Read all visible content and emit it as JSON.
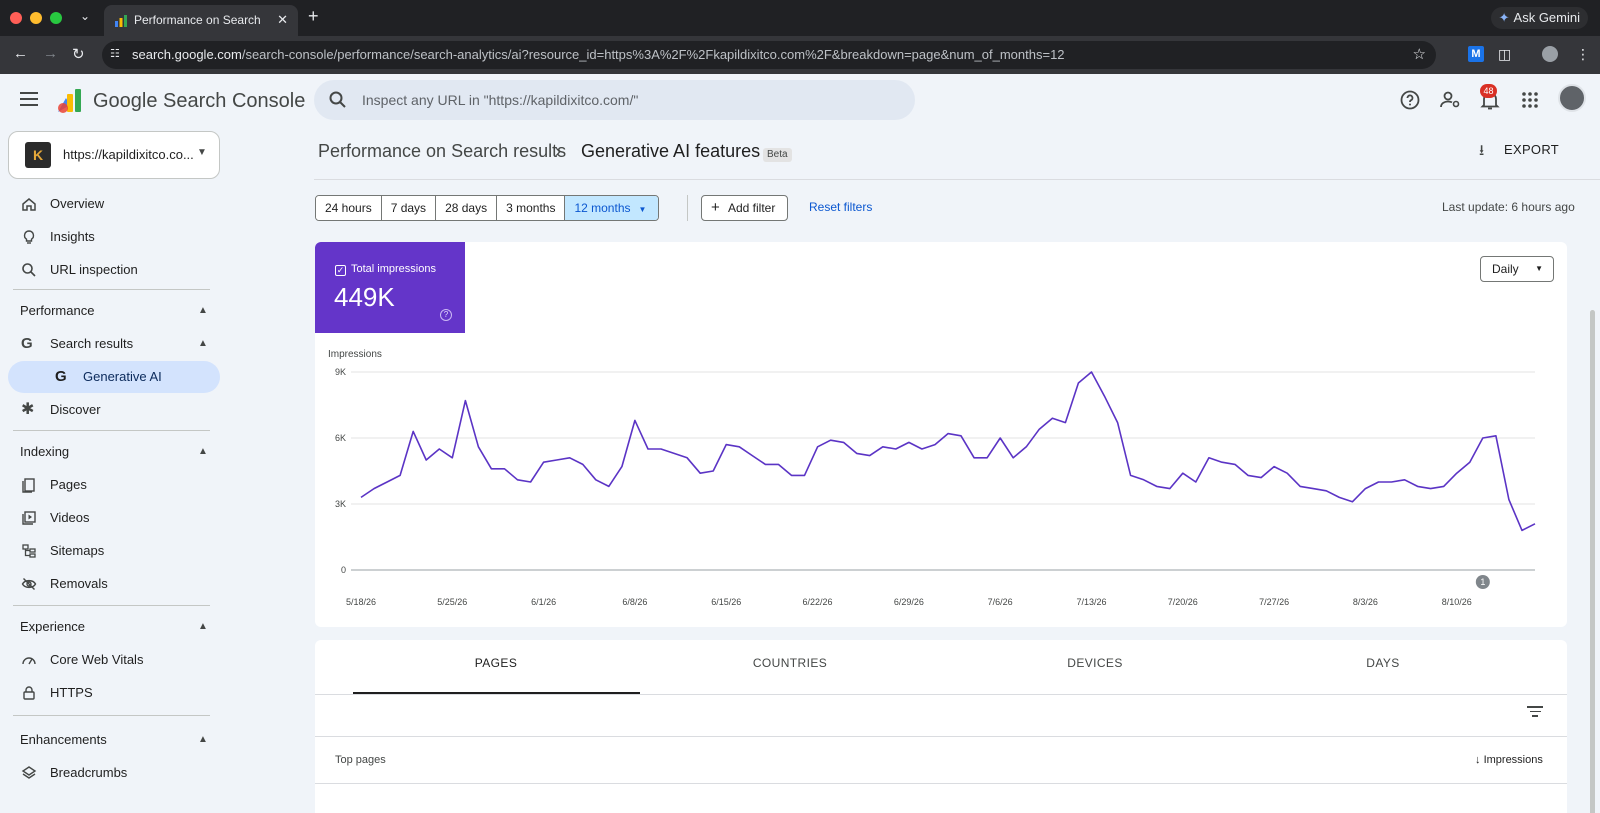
{
  "browser": {
    "tab_title": "Performance on Search generative AI",
    "new_tab": "+",
    "gemini_label": "Ask Gemini",
    "url_host": "search.google.com",
    "url_path": "/search-console/performance/search-analytics/ai?resource_id=https%3A%2F%2Fkapildixitco.com%2F&breakdown=page&num_of_months=12"
  },
  "header": {
    "product_name": "Google Search Console",
    "inspect_placeholder": "Inspect any URL in \"https://kapildixitco.com/\"",
    "notifications_count": "48"
  },
  "property": {
    "logo_text": "K",
    "url": "https://kapildixitco.co..."
  },
  "sidebar": {
    "overview": "Overview",
    "insights": "Insights",
    "url_inspection": "URL inspection",
    "performance_header": "Performance",
    "search_results": "Search results",
    "generative_ai": "Generative AI",
    "discover": "Discover",
    "indexing_header": "Indexing",
    "pages": "Pages",
    "videos": "Videos",
    "sitemaps": "Sitemaps",
    "removals": "Removals",
    "experience_header": "Experience",
    "core_web_vitals": "Core Web Vitals",
    "https": "HTTPS",
    "enhancements_header": "Enhancements",
    "breadcrumbs": "Breadcrumbs"
  },
  "main": {
    "breadcrumb_parent": "Performance on Search results",
    "breadcrumb_current": "Generative AI features",
    "beta_badge": "Beta",
    "export_label": "EXPORT",
    "date_ranges": [
      "24 hours",
      "7 days",
      "28 days",
      "3 months",
      "12 months"
    ],
    "selected_range": "12 months",
    "add_filter": "Add filter",
    "reset_filters": "Reset filters",
    "last_update": "Last update: 6 hours ago",
    "metric_label": "Total impressions",
    "metric_value": "449K",
    "granularity": "Daily",
    "annotation_marker": "1"
  },
  "table": {
    "tabs": [
      "PAGES",
      "COUNTRIES",
      "DEVICES",
      "DAYS"
    ],
    "active_tab": "PAGES",
    "column_left": "Top pages",
    "column_right": "Impressions"
  },
  "colors": {
    "accent": "#6435c9",
    "line": "#5b34c5",
    "selected_range_bg": "#c2e7ff",
    "link": "#0b57d0"
  },
  "chart_data": {
    "type": "line",
    "ylabel": "Impressions",
    "ylim": [
      0,
      9000
    ],
    "yticks": [
      0,
      3000,
      6000,
      9000
    ],
    "ytick_labels": [
      "0",
      "3K",
      "6K",
      "9K"
    ],
    "xtick_labels": [
      "5/18/26",
      "5/25/26",
      "6/1/26",
      "6/8/26",
      "6/15/26",
      "6/22/26",
      "6/29/26",
      "7/6/26",
      "7/13/26",
      "7/20/26",
      "7/27/26",
      "8/3/26",
      "8/10/26"
    ],
    "x_start": "5/18/26",
    "series": [
      {
        "values": [
          3300,
          3700,
          4000,
          4300,
          6300,
          5000,
          5500,
          5100,
          7700,
          5600,
          4600,
          4600,
          4100,
          4000,
          4900,
          5000,
          5100,
          4800,
          4100,
          3800,
          4700,
          6800,
          5500,
          5500,
          5300,
          5100,
          4400,
          4500,
          5700,
          5600,
          5200,
          4800,
          4800,
          4300,
          4300,
          5600,
          5900,
          5800,
          5300,
          5200,
          5600,
          5500,
          5800,
          5500,
          5700,
          6200,
          6100,
          5100,
          5100,
          6000,
          5100,
          5600,
          6400,
          6900,
          6700,
          8500,
          9000,
          7900,
          6700,
          4300,
          4100,
          3800,
          3700,
          4400,
          4000,
          5100,
          4900,
          4800,
          4300,
          4200,
          4700,
          4400,
          3800,
          3700,
          3600,
          3300,
          3100,
          3700,
          4000,
          4000,
          4100,
          3800,
          3700,
          3800,
          4400,
          4900,
          6000,
          6100,
          3200,
          1800,
          2100
        ]
      }
    ]
  }
}
